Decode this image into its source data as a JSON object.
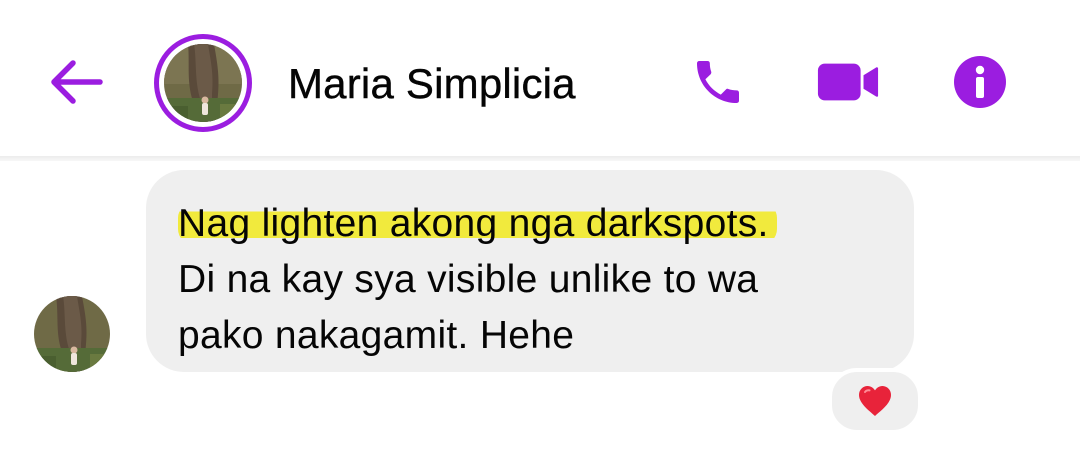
{
  "header": {
    "contact_name": "Maria Simplicia",
    "back_icon": "arrow-left-icon",
    "call_icon": "phone-icon",
    "video_icon": "video-camera-icon",
    "info_icon": "info-icon"
  },
  "message": {
    "lines": [
      "Nag lighten akong nga darkspots.",
      "Di na kay sya visible unlike to wa",
      "pako nakagamit. Hehe"
    ],
    "highlighted_line": 0,
    "reaction": "❤️"
  },
  "colors": {
    "accent": "#9b1de0",
    "bubble": "#efefef",
    "highlight": "#f1ea3d",
    "reaction_heart": "#e8233a"
  }
}
